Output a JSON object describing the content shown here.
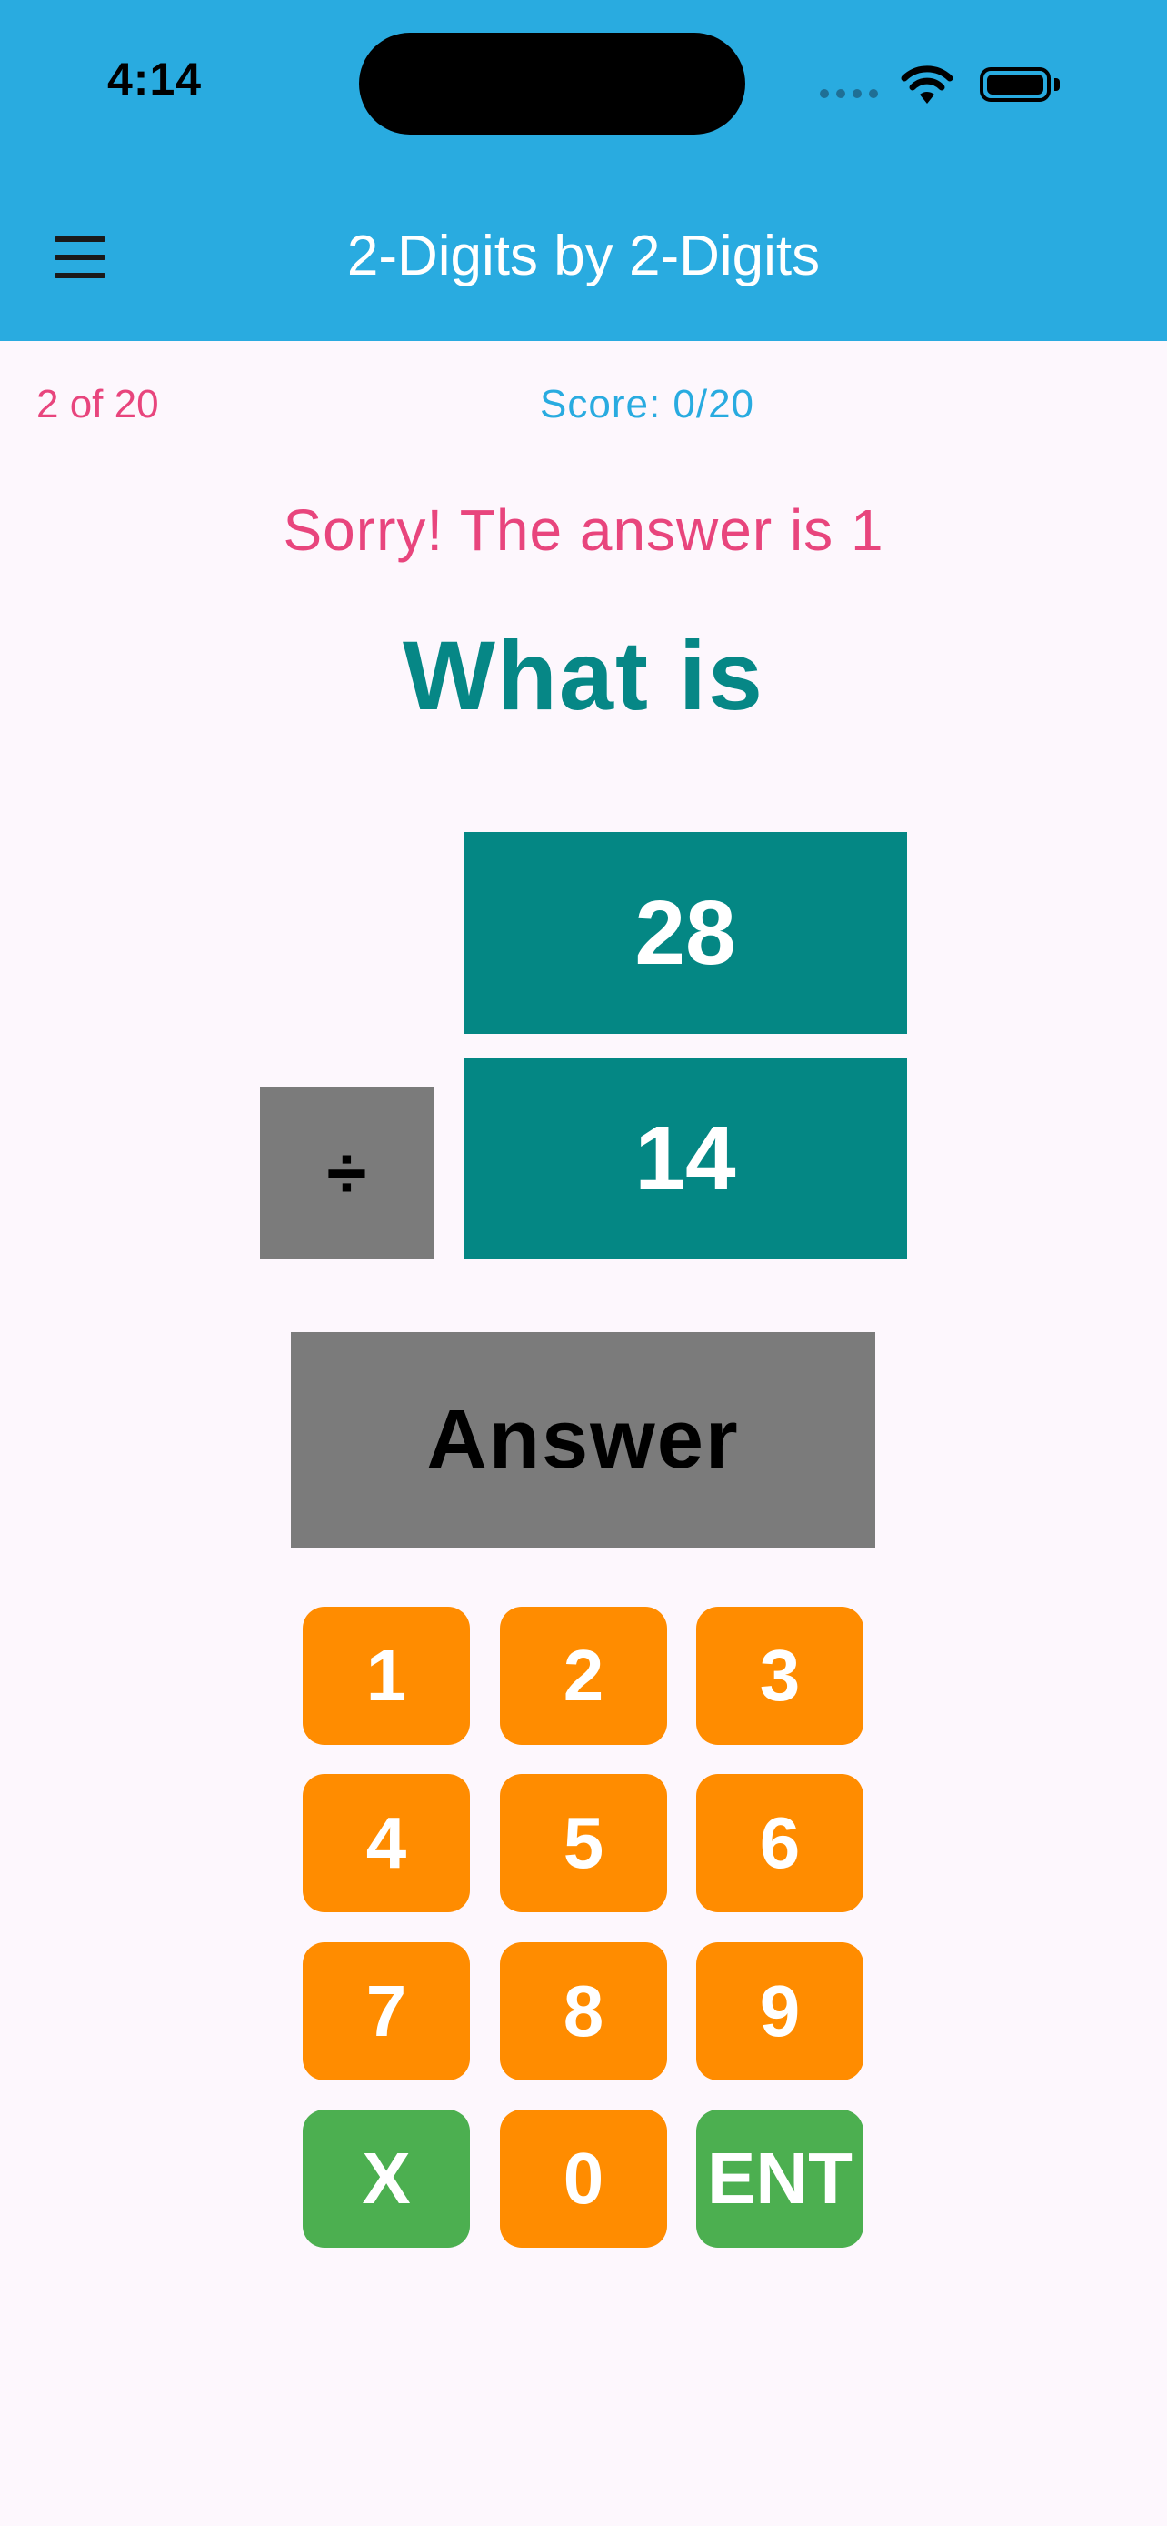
{
  "status_bar": {
    "time": "4:14"
  },
  "app_bar": {
    "title": "2-Digits by 2-Digits",
    "menu_icon": "hamburger-menu-icon"
  },
  "progress": {
    "label": "2 of 20"
  },
  "score": {
    "label": "Score: 0/20"
  },
  "feedback": {
    "text": "Sorry! The answer is 1"
  },
  "question": {
    "prompt": "What is",
    "top_number": "28",
    "operator": "÷",
    "bottom_number": "14",
    "answer_placeholder": "Answer"
  },
  "keypad": {
    "keys": [
      "1",
      "2",
      "3",
      "4",
      "5",
      "6",
      "7",
      "8",
      "9",
      "X",
      "0",
      "ENT"
    ]
  },
  "colors": {
    "header": "#29abe0",
    "accent_pink": "#e8457d",
    "teal": "#048784",
    "key_orange": "#ff8c00",
    "key_green": "#4caf50",
    "gray": "#7b7b7b",
    "background": "#fdf7fd"
  }
}
